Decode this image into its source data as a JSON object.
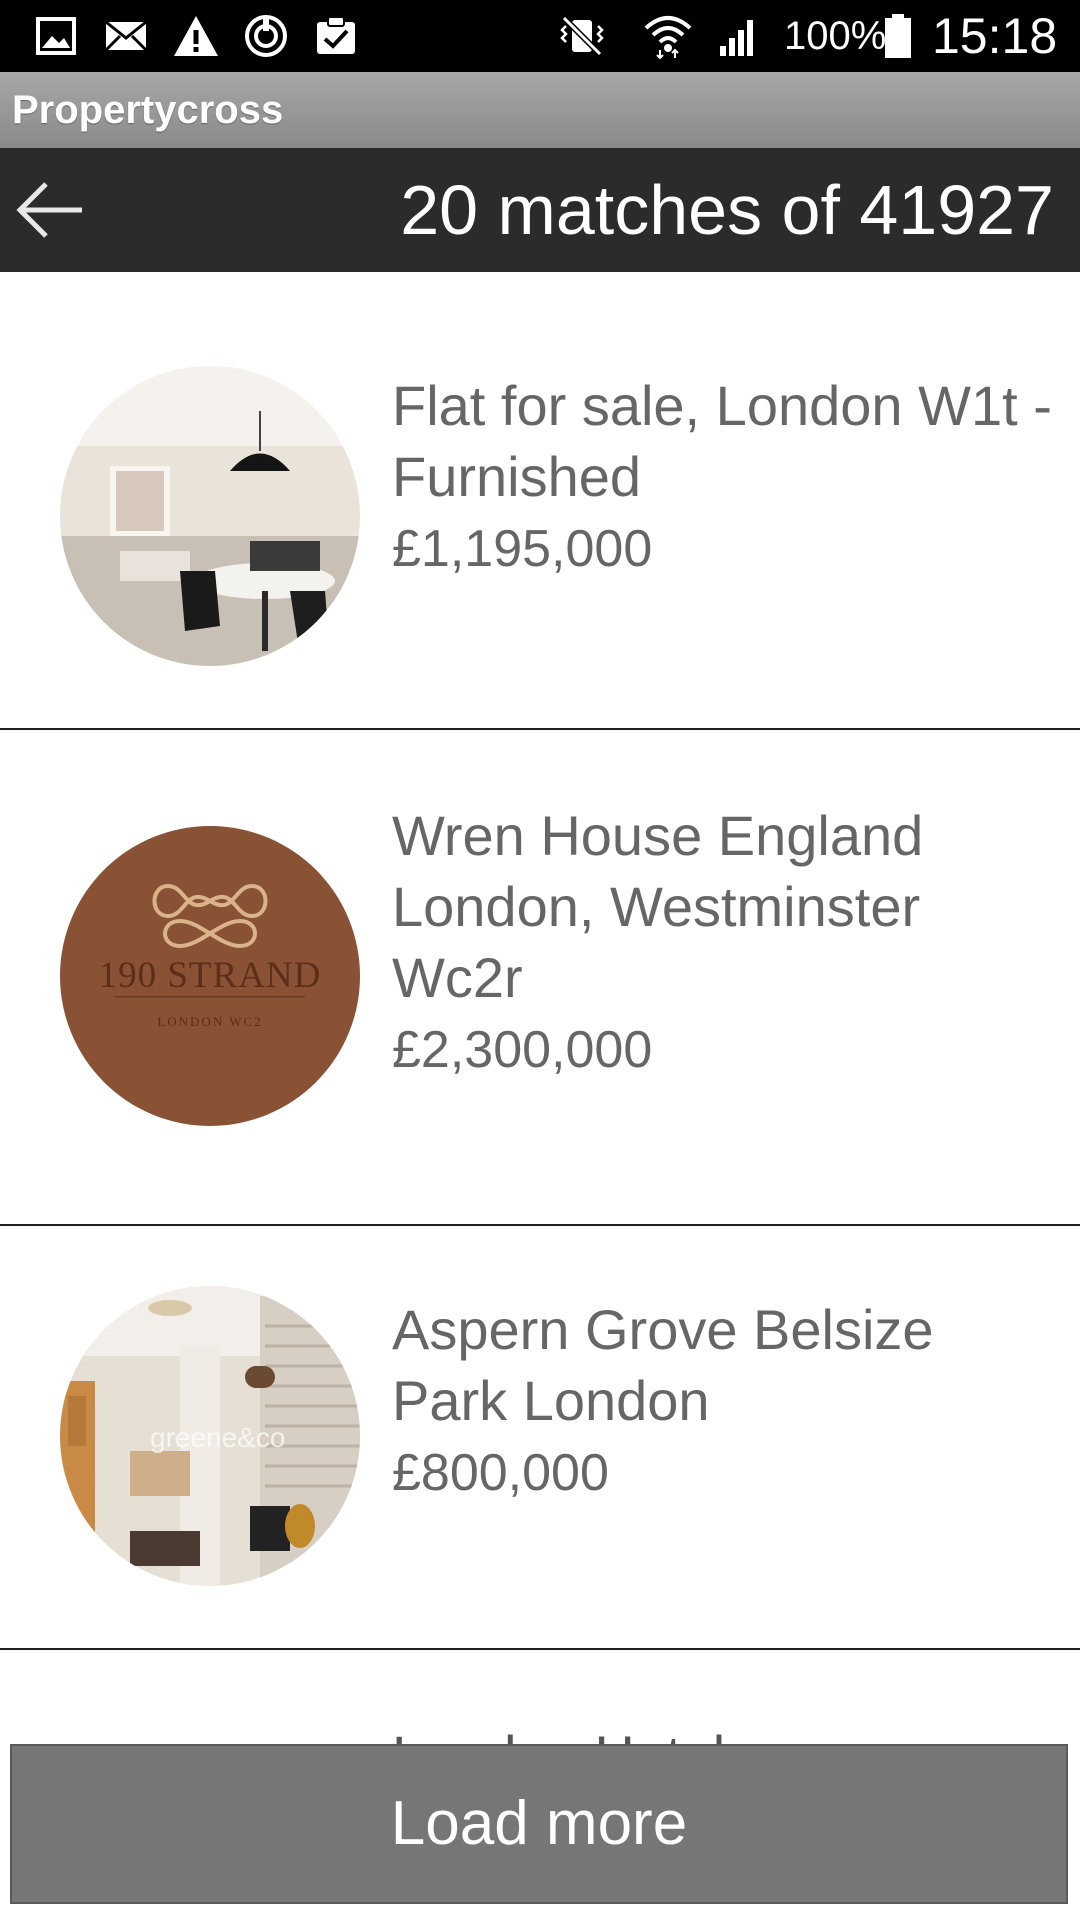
{
  "status_bar": {
    "left_icons": [
      "image-icon",
      "mail-icon",
      "warning-icon",
      "sync-icon",
      "clipboard-check-icon"
    ],
    "right_icons": [
      "vibrate-icon",
      "wifi-icon",
      "signal-icon",
      "battery-icon"
    ],
    "battery": "100%",
    "time": "15:18"
  },
  "app": {
    "title": "Propertycross"
  },
  "header": {
    "title": "20 matches of 41927",
    "back_icon": "back-arrow-icon"
  },
  "listings": [
    {
      "title": "Flat for sale, London W1t - Furnished",
      "price": "£1,195,000"
    },
    {
      "title": "Wren House England London, Westminster Wc2r",
      "price": "£2,300,000",
      "logo_text": "190 STRAND",
      "logo_subtext": "LONDON WC2"
    },
    {
      "title": "Aspern Grove Belsize Park London",
      "price": "£800,000",
      "watermark": "greene&co"
    }
  ],
  "partial_listing": {
    "title": "London Hotel"
  },
  "load_more": {
    "label": "Load more"
  },
  "colors": {
    "status_bar": "#000000",
    "app_bar": "#9a9a9a",
    "header": "#2b2b2b",
    "text": "#666666",
    "divider": "#1f1f1f",
    "button": "#767676",
    "logo_background": "#8a5235"
  }
}
